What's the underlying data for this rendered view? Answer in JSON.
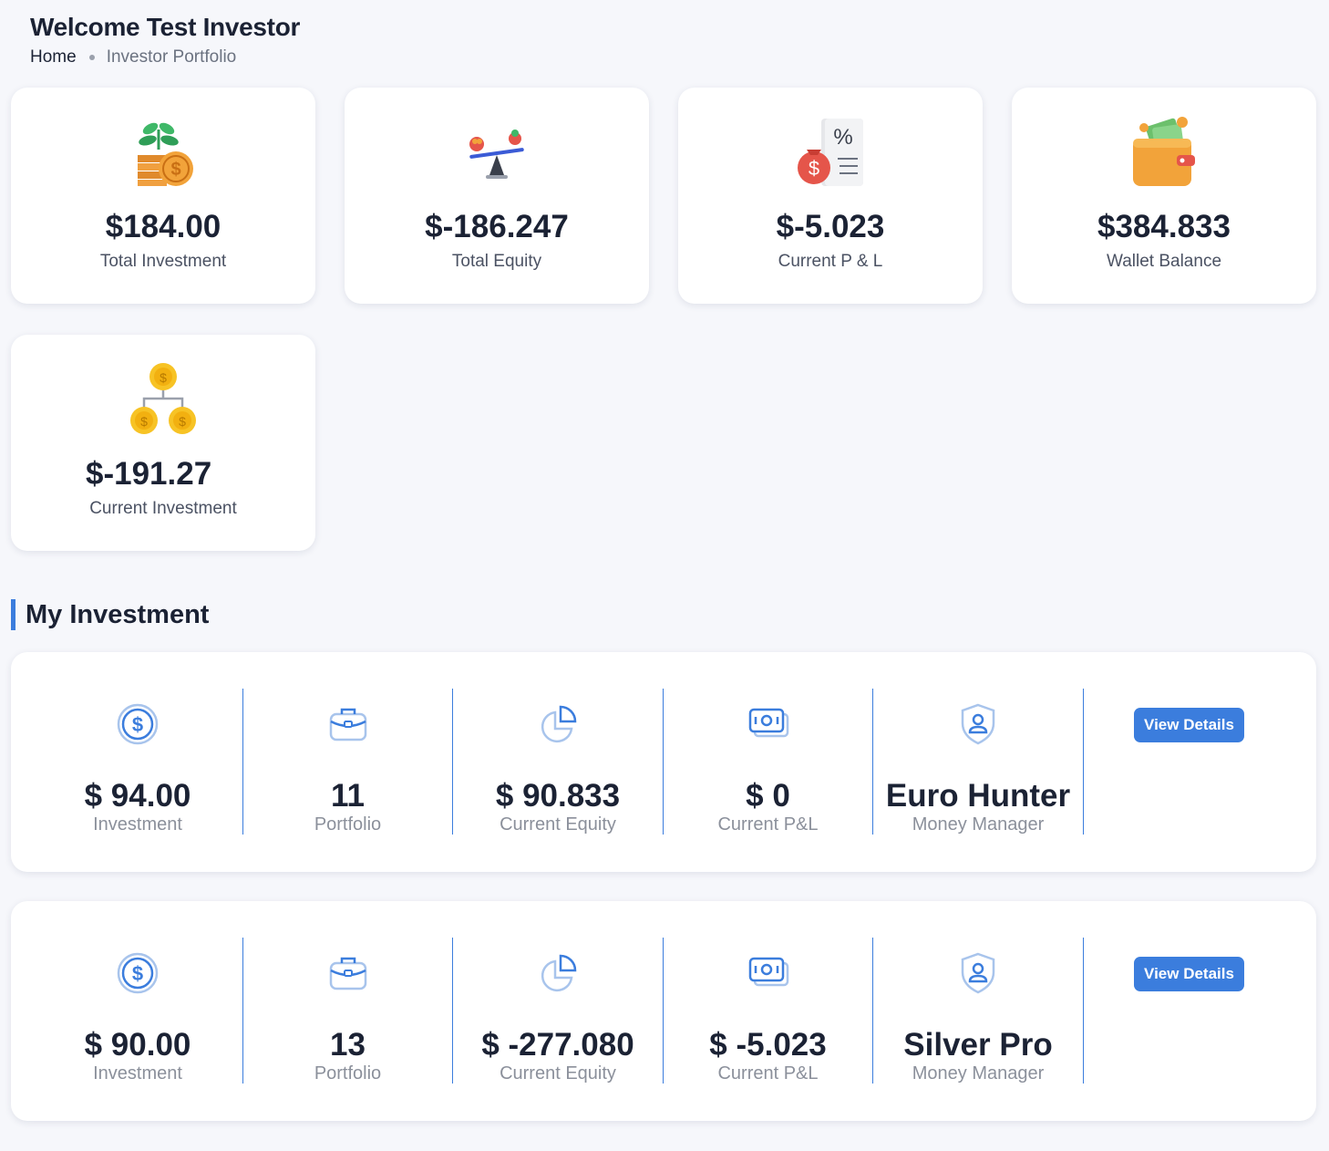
{
  "header": {
    "title": "Welcome Test Investor",
    "breadcrumb": {
      "home": "Home",
      "current": "Investor Portfolio"
    }
  },
  "stats": [
    {
      "value": "$184.00",
      "label": "Total Investment",
      "icon": "plant-coins-icon"
    },
    {
      "value": "$-186.247",
      "label": "Total Equity",
      "icon": "balance-scale-icon"
    },
    {
      "value": "$-5.023",
      "label": "Current P & L",
      "icon": "money-bag-percent-icon"
    },
    {
      "value": "$384.833",
      "label": "Wallet Balance",
      "icon": "wallet-icon"
    },
    {
      "value": "$-191.27",
      "label": "Current Investment",
      "icon": "coins-tree-icon"
    }
  ],
  "section": {
    "title": "My Investment"
  },
  "investments": [
    {
      "investment": {
        "value": "$ 94.00",
        "label": "Investment"
      },
      "portfolio": {
        "value": "11",
        "label": "Portfolio"
      },
      "equity": {
        "value": "$ 90.833",
        "label": "Current Equity"
      },
      "pnl": {
        "value": "$ 0",
        "label": "Current P&L"
      },
      "manager": {
        "value": "Euro Hunter",
        "label": "Money Manager"
      },
      "button": "View Details"
    },
    {
      "investment": {
        "value": "$ 90.00",
        "label": "Investment"
      },
      "portfolio": {
        "value": "13",
        "label": "Portfolio"
      },
      "equity": {
        "value": "$ -277.080",
        "label": "Current Equity"
      },
      "pnl": {
        "value": "$ -5.023",
        "label": "Current P&L"
      },
      "manager": {
        "value": "Silver Pro",
        "label": "Money Manager"
      },
      "button": "View Details"
    }
  ],
  "colors": {
    "accent": "#3b7ddd",
    "background": "#f6f7fb",
    "card": "#ffffff"
  }
}
